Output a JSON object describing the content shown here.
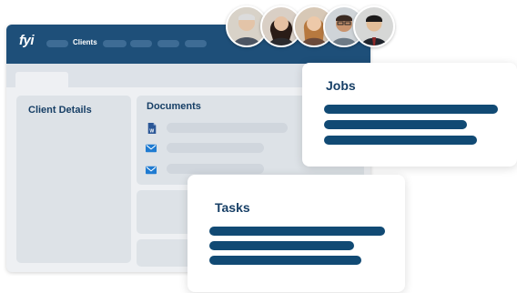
{
  "app": {
    "logo": "fyi",
    "nav": {
      "active_label": "Clients"
    }
  },
  "panels": {
    "client_details": {
      "title": "Client Details"
    },
    "documents": {
      "title": "Documents",
      "items": [
        {
          "icon": "word-doc-icon"
        },
        {
          "icon": "mail-icon"
        },
        {
          "icon": "mail-icon"
        }
      ]
    }
  },
  "cards": {
    "jobs": {
      "title": "Jobs"
    },
    "tasks": {
      "title": "Tasks"
    }
  },
  "colors": {
    "brand_navy": "#1e4f79",
    "bar_blue": "#114a74",
    "title_blue": "#173f66",
    "word_blue": "#2b5797",
    "mail_blue": "#1f7bd1"
  }
}
